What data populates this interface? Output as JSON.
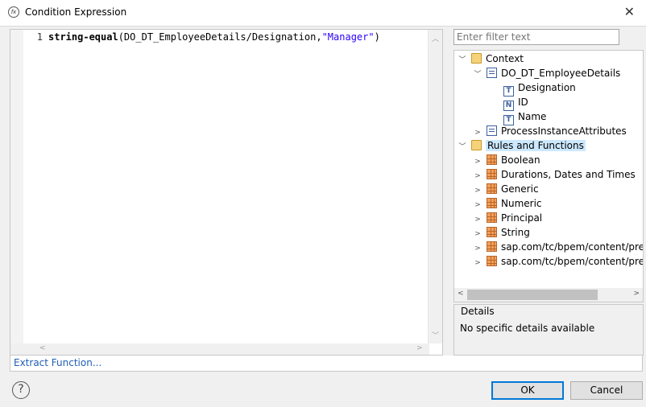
{
  "window": {
    "title": "Condition Expression",
    "close_label": "✕"
  },
  "editor": {
    "line_number": "1",
    "code_function": "string-equal",
    "code_args": "(DO_DT_EmployeeDetails/Designation,",
    "code_string": "\"Manager\"",
    "code_close": ")"
  },
  "extract_label": "Extract Function...",
  "filter": {
    "placeholder": "Enter filter text"
  },
  "tree": {
    "context": "Context",
    "employee_details": "DO_DT_EmployeeDetails",
    "designation": "Designation",
    "designation_type": "T",
    "id": "ID",
    "id_type": "N",
    "name": "Name",
    "name_type": "T",
    "process_instance": "ProcessInstanceAttributes",
    "rules_and_functions": "Rules and Functions",
    "functions": [
      "Boolean",
      "Durations, Dates and Times",
      "Generic",
      "Numeric",
      "Principal",
      "String",
      "sap.com/tc/bpem/content/prede",
      "sap.com/tc/bpem/content/prede"
    ]
  },
  "details": {
    "title": "Details",
    "text": "No specific details available"
  },
  "buttons": {
    "help": "?",
    "ok": "OK",
    "cancel": "Cancel"
  }
}
